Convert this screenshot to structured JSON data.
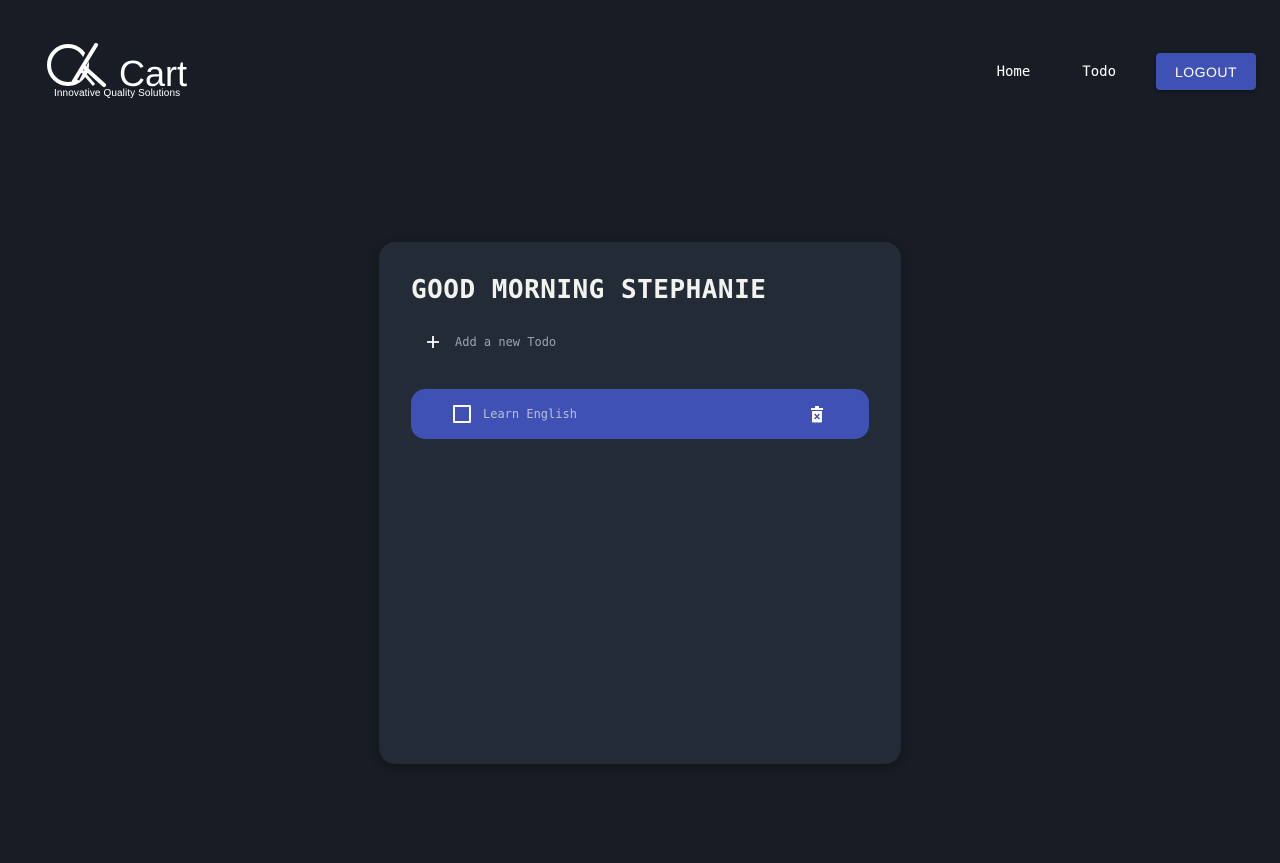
{
  "header": {
    "logo": {
      "brand_mark": "QK",
      "brand_name": "Cart",
      "tagline": "Innovative Quality Solutions",
      "icon": "qkart-logo"
    },
    "nav": {
      "home_label": "Home",
      "todo_label": "Todo",
      "logout_label": "LOGOUT"
    }
  },
  "main": {
    "greeting": "GOOD MORNING STEPHANIE",
    "add_todo": {
      "icon": "plus-icon",
      "placeholder": "Add a new Todo"
    },
    "todos": [
      {
        "text": "Learn English",
        "completed": false,
        "delete_icon": "delete-forever-icon"
      }
    ]
  },
  "colors": {
    "background": "#181d25",
    "card": "#222b36",
    "accent": "#3f51b5",
    "greeting_text": "#f2f2ee",
    "muted_text": "#9aa3ad"
  }
}
